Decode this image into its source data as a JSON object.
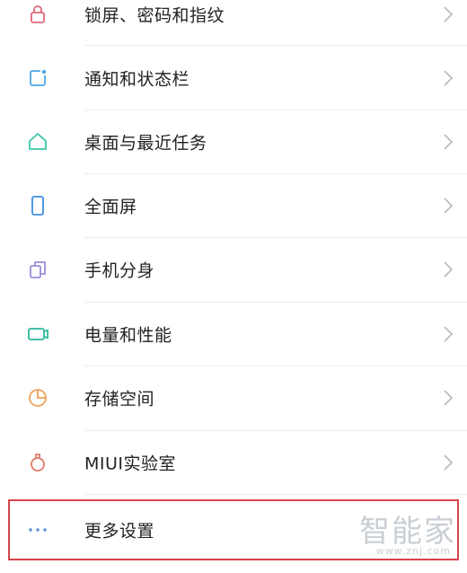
{
  "settings": {
    "items": [
      {
        "label": "锁屏、密码和指纹",
        "icon": "lock-icon",
        "icon_color": "#e0677a"
      },
      {
        "label": "通知和状态栏",
        "icon": "notification-icon",
        "icon_color": "#4fa8e8"
      },
      {
        "label": "桌面与最近任务",
        "icon": "home-icon",
        "icon_color": "#3cc4a6"
      },
      {
        "label": "全面屏",
        "icon": "phone-icon",
        "icon_color": "#3e8fe0"
      },
      {
        "label": "手机分身",
        "icon": "copy-icon",
        "icon_color": "#9b8ed8"
      },
      {
        "label": "电量和性能",
        "icon": "battery-icon",
        "icon_color": "#2fb89a"
      },
      {
        "label": "存储空间",
        "icon": "pie-chart-icon",
        "icon_color": "#f0a05a"
      },
      {
        "label": "MIUI实验室",
        "icon": "flask-icon",
        "icon_color": "#e07a6a"
      },
      {
        "label": "更多设置",
        "icon": "more-dots-icon",
        "icon_color": "#5a8ed8"
      }
    ]
  },
  "watermark": {
    "main": "智能家",
    "sub": "www.znj.com"
  },
  "colors": {
    "highlight_border": "#d6444b",
    "chevron": "#bdbdbd",
    "divider": "#ececec"
  }
}
